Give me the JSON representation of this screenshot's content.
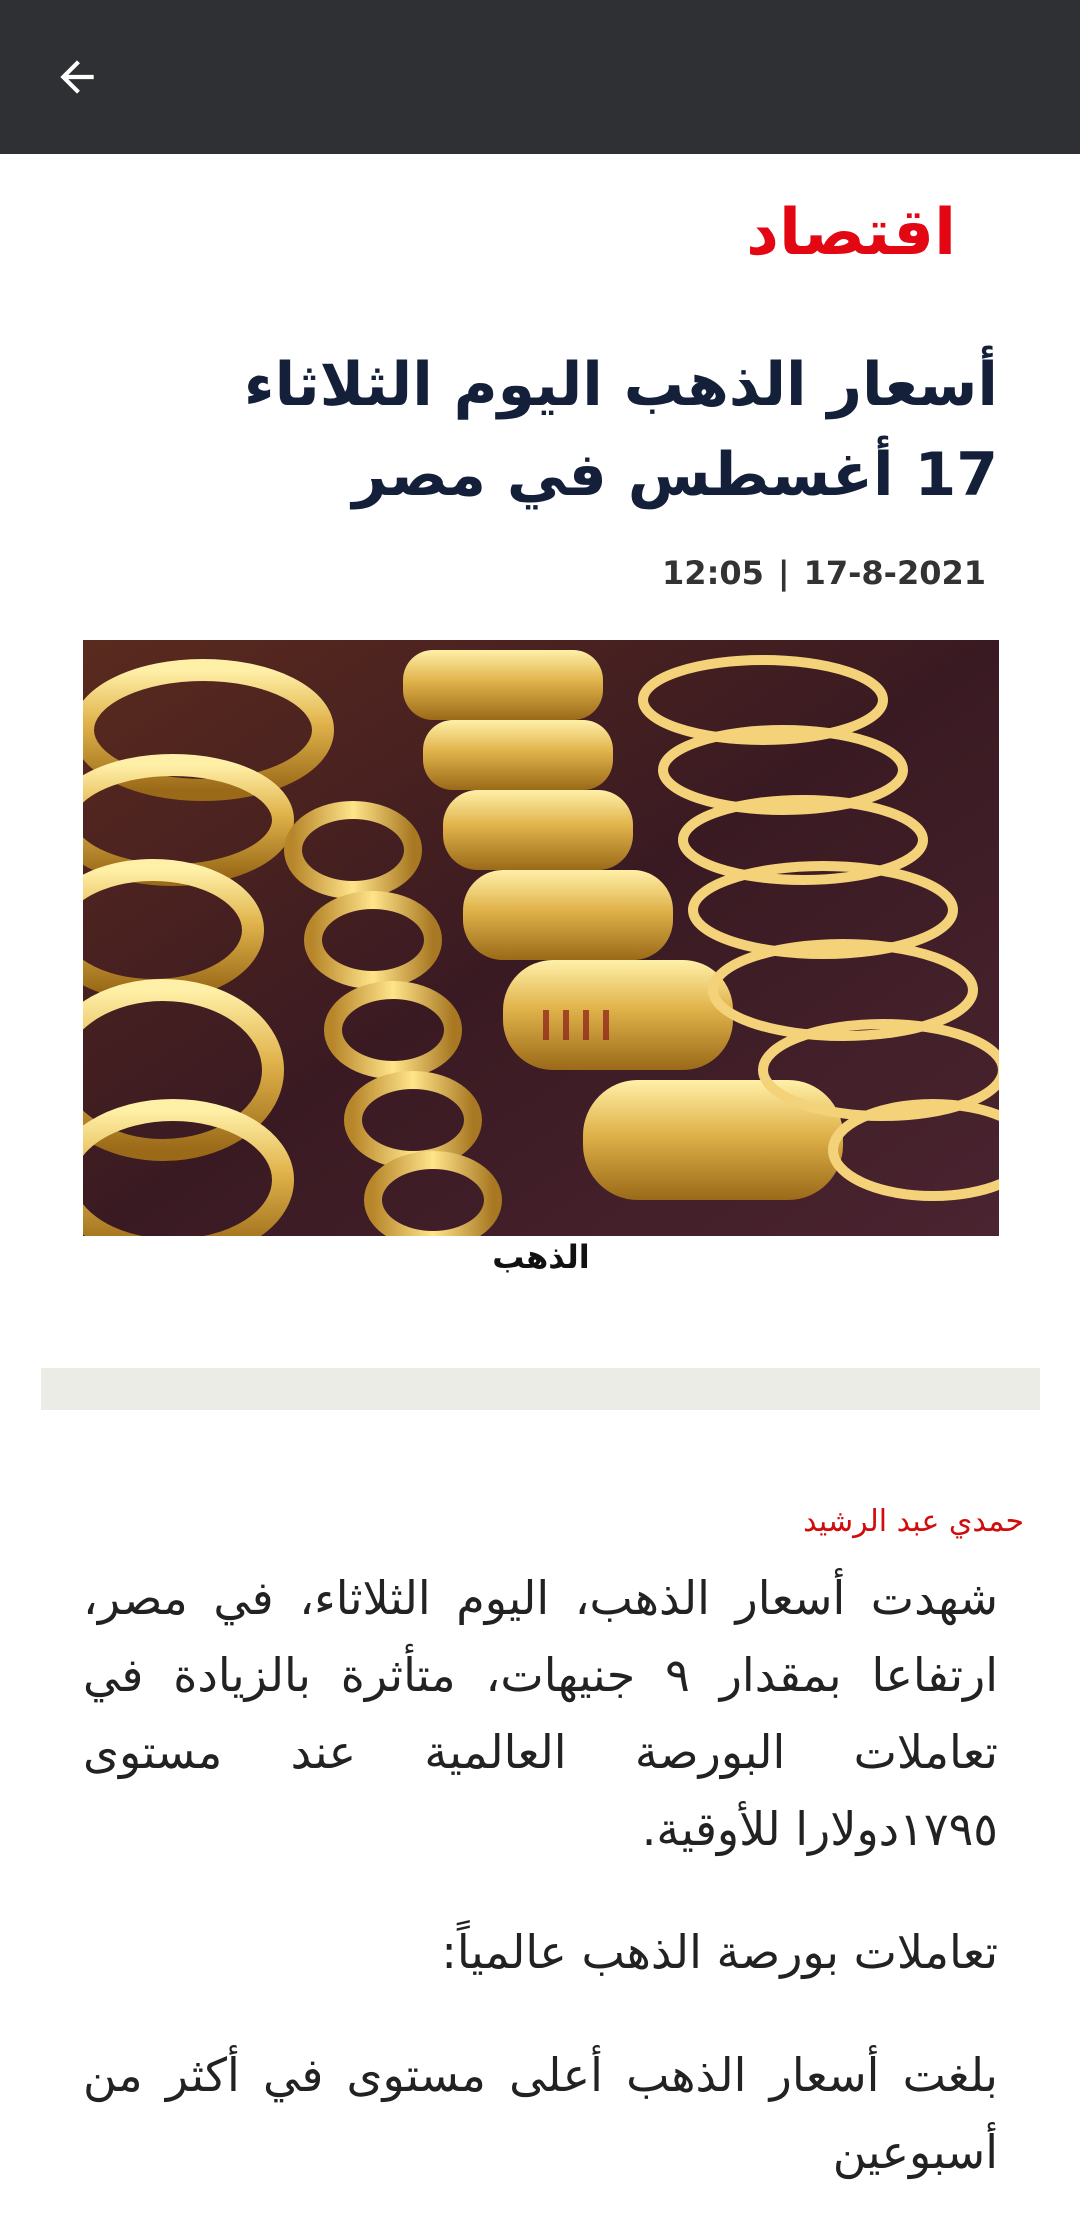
{
  "appbar": {
    "back_icon": "arrow-left-icon",
    "background_color": "#2e3033"
  },
  "article": {
    "category": "اقتصاد",
    "headline": "أسعار الذهب اليوم الثلاثاء 17 أغسطس في مصر",
    "date": "17-8-2021",
    "separator": "|",
    "time": "12:05",
    "image_caption": "الذهب",
    "author": "حمدي عبد الرشيد",
    "paragraphs": {
      "p1": "شهدت أسعار الذهب، اليوم الثلاثاء، في مصر، ارتفاعا بمقدار ٩ جنيهات، متأثرة بالزيادة في تعاملات البورصة العالمية عند مستوى ١٧٩٥دولارا للأوقية.",
      "p2": "تعاملات بورصة الذهب عالمياً:",
      "p3": "بلغت أسعار الذهب أعلى مستوى في أكثر من أسبوعين"
    }
  },
  "colors": {
    "accent": "#e30613",
    "headline": "#14203a",
    "author": "#d10c0c",
    "divider": "#ecece7"
  }
}
